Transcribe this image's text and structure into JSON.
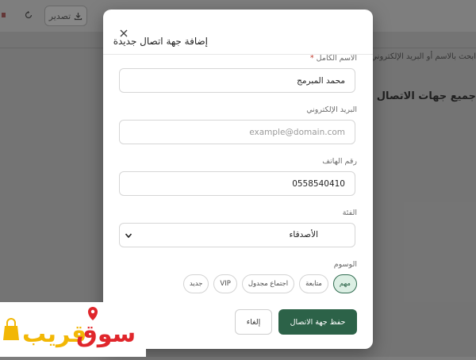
{
  "background": {
    "toolbar": {
      "export_label": "تصدير",
      "export_icon": "download-icon",
      "refresh_icon": "refresh-icon"
    },
    "search_placeholder": "ابحث بالاسم أو البريد الإلكتروني",
    "section_title": "جميع جهات الاتصال"
  },
  "modal": {
    "title": "إضافة جهة اتصال جديدة",
    "close_icon": "close-icon",
    "fields": {
      "full_name": {
        "label": "الاسم الكامل",
        "required_mark": "*",
        "value": "محمد المبرمج"
      },
      "email": {
        "label": "البريد الإلكتروني",
        "value": "",
        "placeholder": "example@domain.com"
      },
      "phone": {
        "label": "رقم الهاتف",
        "value": "0558540410"
      },
      "category": {
        "label": "الفئة",
        "selected": "الأصدقاء"
      }
    },
    "tags": {
      "label": "الوسوم",
      "items": [
        {
          "label": "مهم",
          "selected": true
        },
        {
          "label": "متابعة",
          "selected": false
        },
        {
          "label": "اجتماع مجدول",
          "selected": false
        },
        {
          "label": "VIP",
          "selected": false
        },
        {
          "label": "جديد",
          "selected": false
        }
      ]
    },
    "actions": {
      "save_label": "حفظ جهة الاتصال",
      "cancel_label": "إلغاء"
    }
  },
  "watermark": {
    "text": "سوق قريب"
  },
  "colors": {
    "primary": "#2c6248",
    "tag_active_bg": "#dcefe4",
    "required": "#c0392b",
    "logo_red": "#e0262b",
    "logo_yellow": "#f2b705"
  }
}
